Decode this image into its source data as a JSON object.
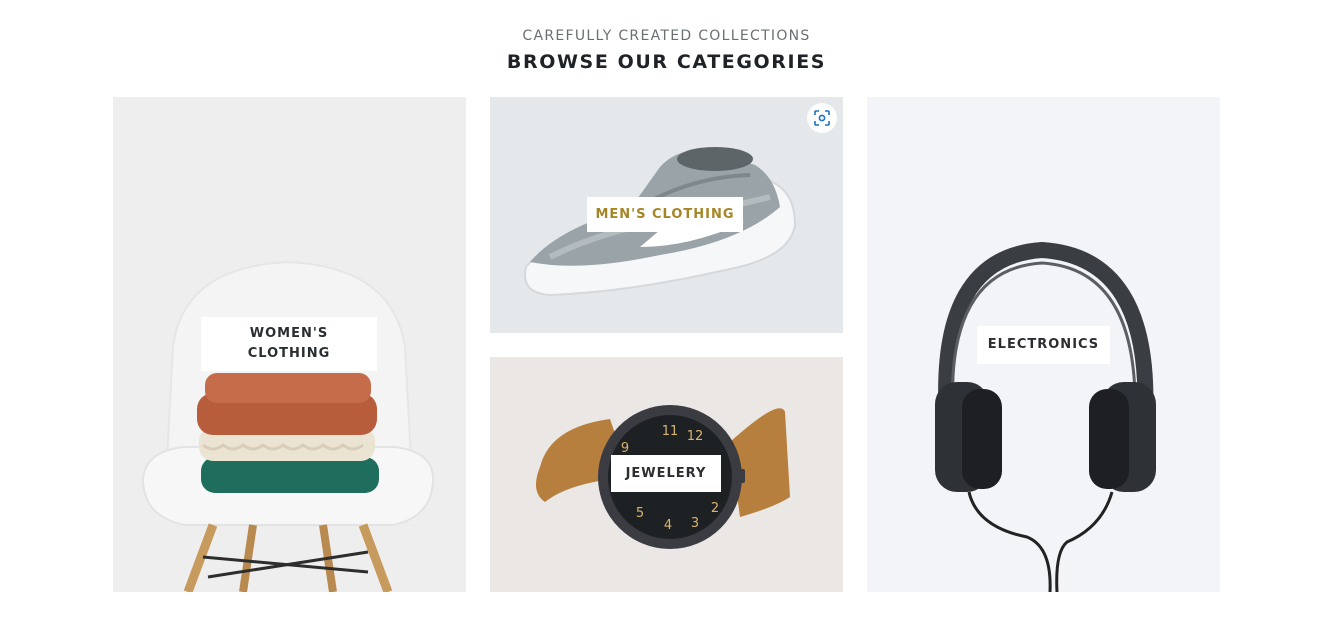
{
  "section": {
    "kicker": "CAREFULLY CREATED COLLECTIONS",
    "title": "BROWSE OUR CATEGORIES"
  },
  "categories": [
    {
      "label": "WOMEN'S CLOTHING",
      "image": "folded-sweaters-on-chair"
    },
    {
      "label": "MEN'S CLOTHING",
      "image": "grey-running-shoe",
      "accent": "#a68527"
    },
    {
      "label": "JEWELERY",
      "image": "wristwatch"
    },
    {
      "label": "ELECTRONICS",
      "image": "headphones"
    }
  ],
  "icons": {
    "image_search": "lens-search-icon"
  }
}
